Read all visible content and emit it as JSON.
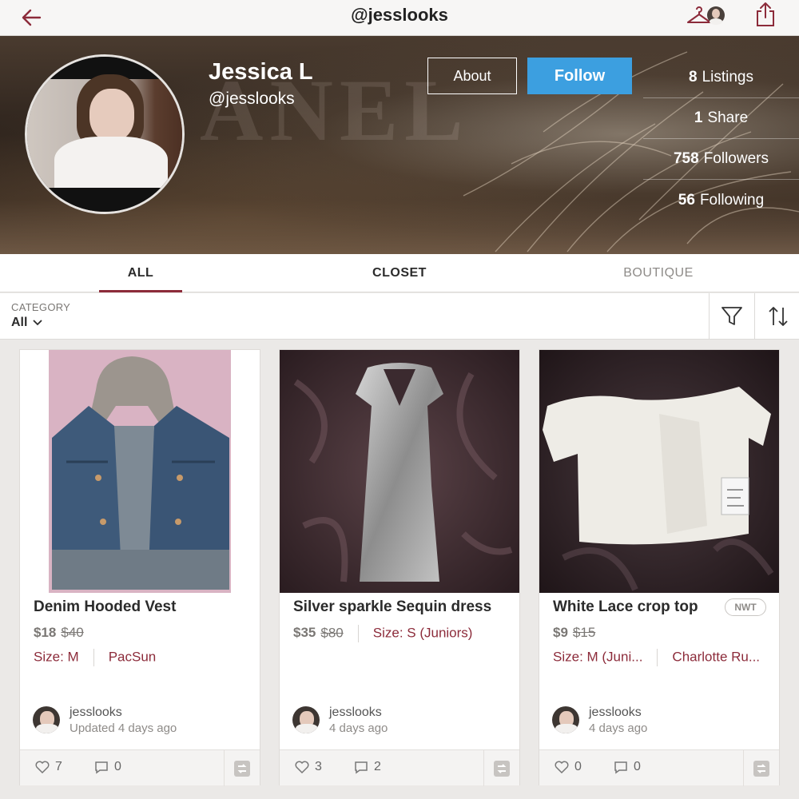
{
  "topbar": {
    "title": "@jesslooks",
    "icons": [
      "back-arrow-icon",
      "hanger-icon",
      "share-icon"
    ]
  },
  "profile": {
    "name": "Jessica L",
    "handle": "@jesslooks",
    "about_label": "About",
    "follow_label": "Follow",
    "follow_color": "#3c9fe0",
    "stats": [
      {
        "num": "8",
        "label": "Listings"
      },
      {
        "num": "1",
        "label": "Share"
      },
      {
        "num": "758",
        "label": "Followers"
      },
      {
        "num": "56",
        "label": "Following"
      }
    ]
  },
  "tabs": [
    {
      "label": "ALL",
      "active": true
    },
    {
      "label": "CLOSET",
      "active": false
    },
    {
      "label": "BOUTIQUE",
      "active": false
    }
  ],
  "filter": {
    "category_label": "CATEGORY",
    "category_value": "All"
  },
  "accent_color": "#8c2b3a",
  "listings": [
    {
      "title": "Denim Hooded Vest",
      "price": "$18",
      "original_price": "$40",
      "size": "Size: M",
      "brand": "PacSun",
      "badge": "",
      "seller": "jesslooks",
      "time": "Updated 4 days ago",
      "likes": "7",
      "comments": "0"
    },
    {
      "title": "Silver sparkle Sequin dress",
      "price": "$35",
      "original_price": "$80",
      "size": "Size: S (Juniors)",
      "brand": "",
      "badge": "",
      "seller": "jesslooks",
      "time": "4 days ago",
      "likes": "3",
      "comments": "2"
    },
    {
      "title": "White Lace crop top",
      "price": "$9",
      "original_price": "$15",
      "size": "Size: M (Juni...",
      "brand": "Charlotte Ru...",
      "badge": "NWT",
      "seller": "jesslooks",
      "time": "4 days ago",
      "likes": "0",
      "comments": "0"
    }
  ]
}
